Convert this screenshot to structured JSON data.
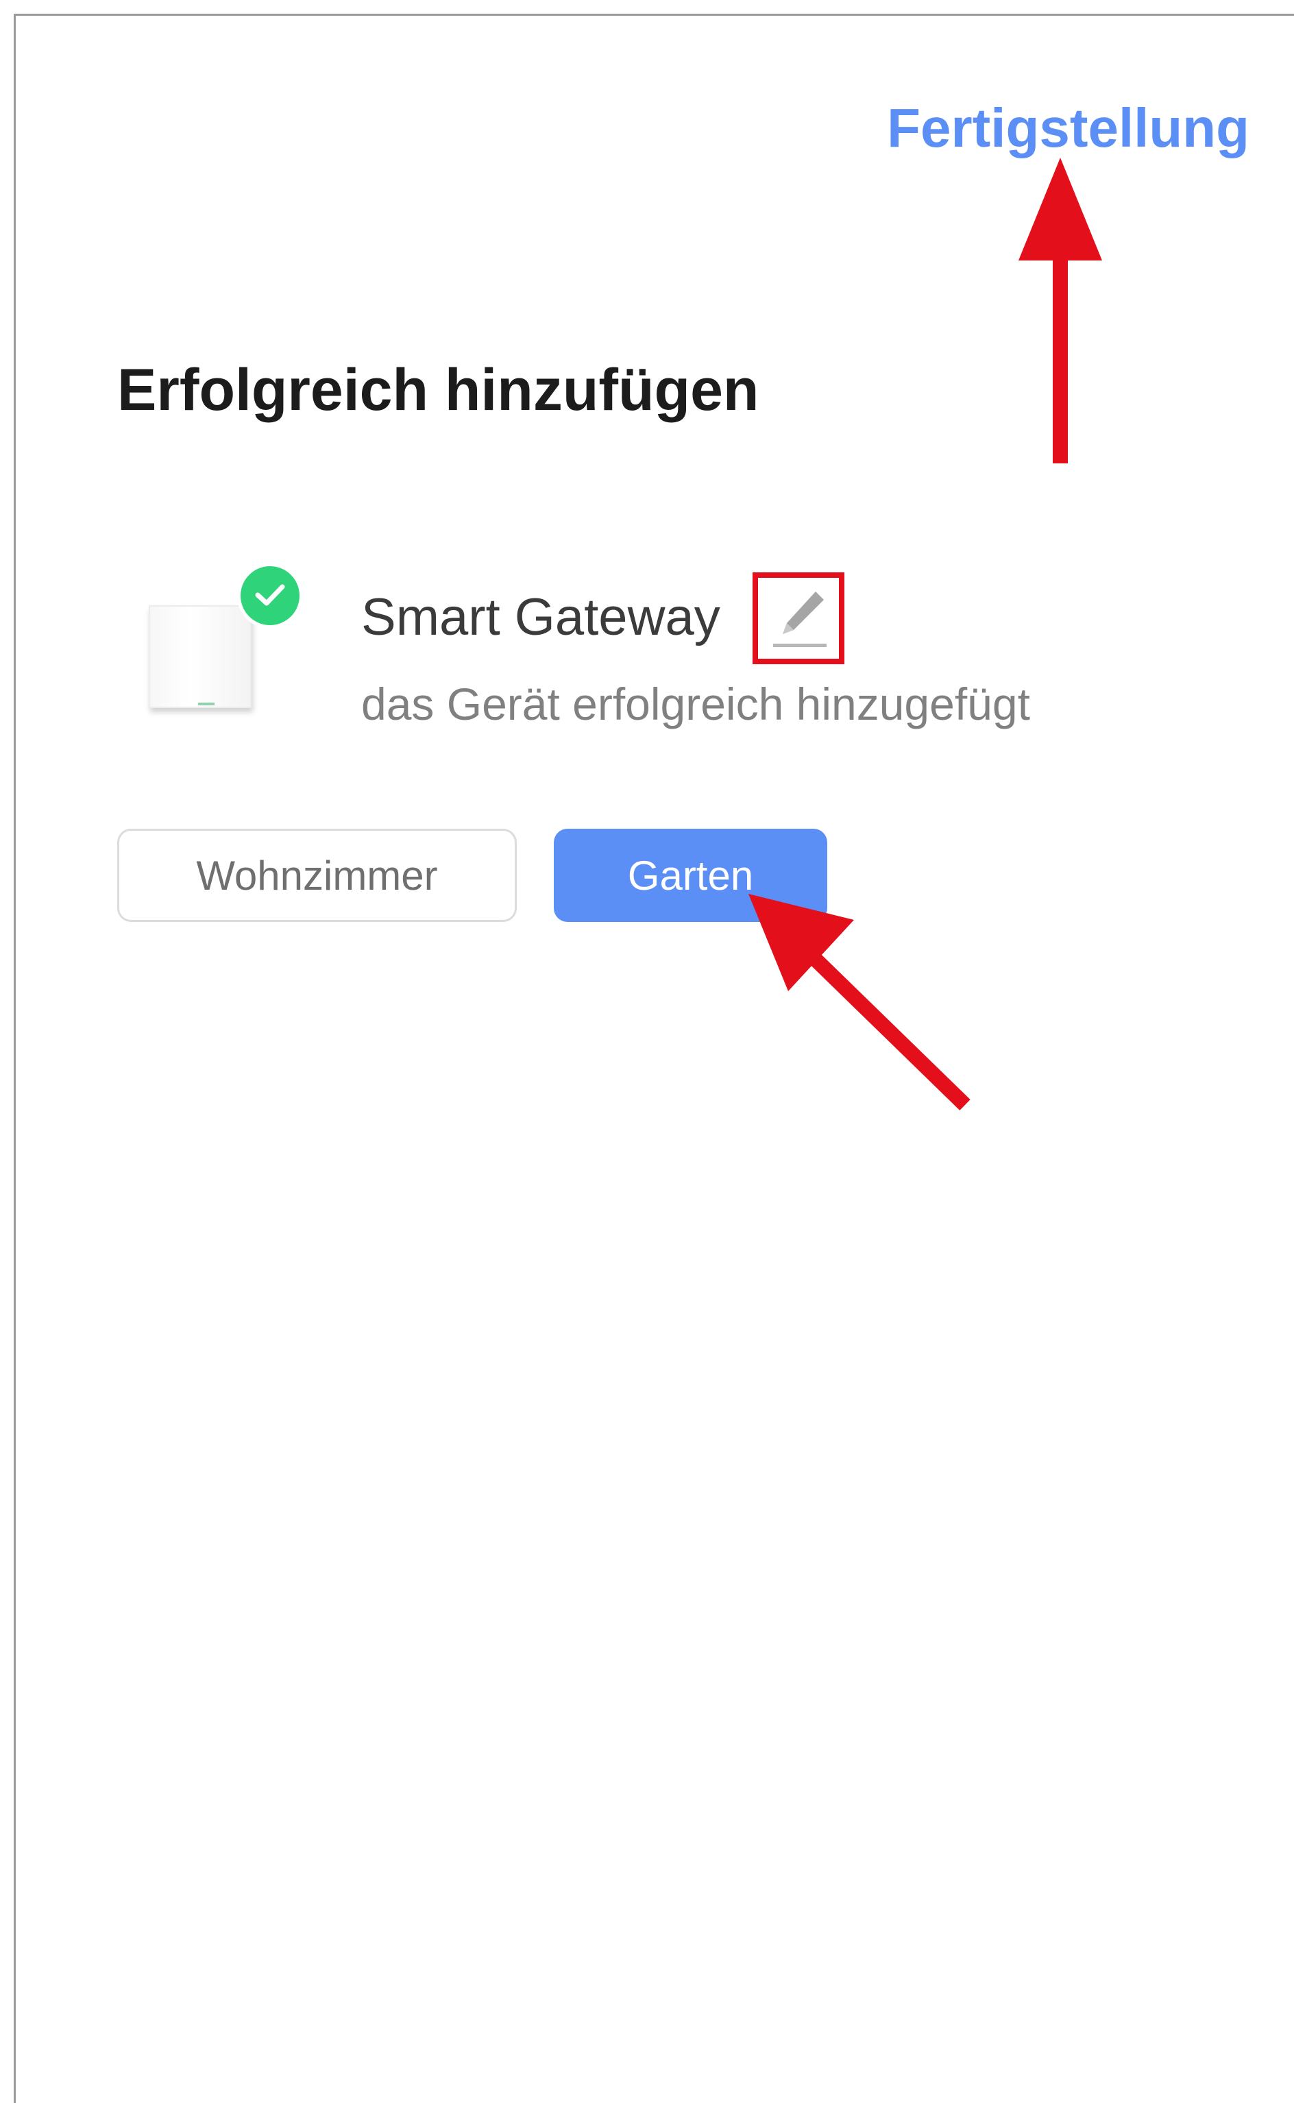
{
  "header": {
    "done_label": "Fertigstellung"
  },
  "page": {
    "title": "Erfolgreich hinzufügen"
  },
  "device": {
    "name": "Smart Gateway",
    "status": "das Gerät erfolgreich hinzugefügt",
    "icon": "gateway-device-icon",
    "badge_icon": "check-icon"
  },
  "rooms": {
    "selected": "Garten",
    "items": [
      {
        "label": "Wohnzimmer"
      },
      {
        "label": "Garten"
      }
    ]
  },
  "colors": {
    "accent": "#5b8ff5",
    "success": "#2fd37a",
    "annotation": "#e3101c"
  }
}
